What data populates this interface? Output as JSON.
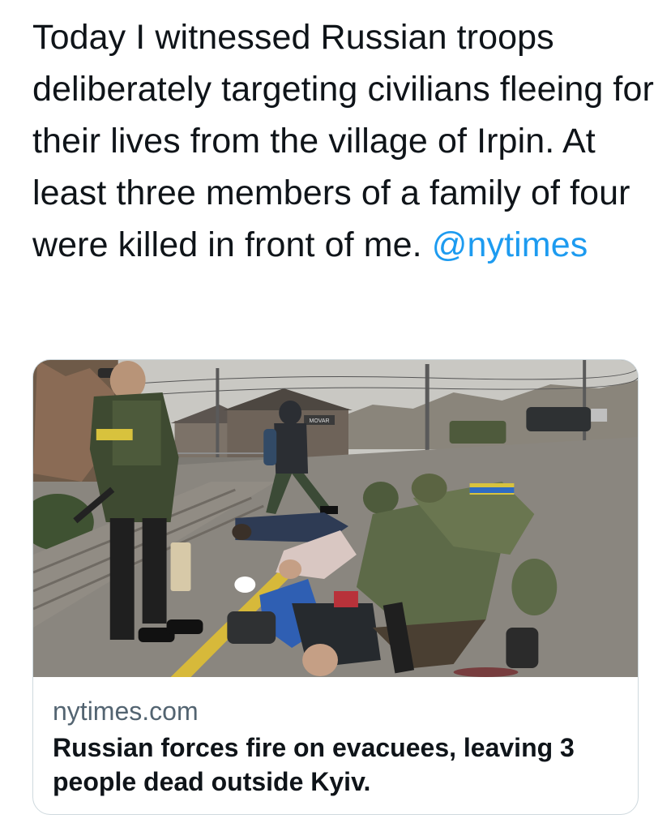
{
  "tweet": {
    "text": "Today I witnessed Russian troops deliberately targeting civilians fleeing for their lives from the village of Irpin. At least three members of a family of four were killed in front of me.",
    "mention": "@nytimes"
  },
  "card": {
    "domain": "nytimes.com",
    "title": "Russian forces fire on evacuees, leaving 3 people dead outside Kyiv.",
    "image": {
      "sign_text": "MOVAR"
    }
  },
  "colors": {
    "text": "#0f1419",
    "mention": "#1d9bf0",
    "card_border": "#cfd9de",
    "card_domain": "#536471"
  }
}
